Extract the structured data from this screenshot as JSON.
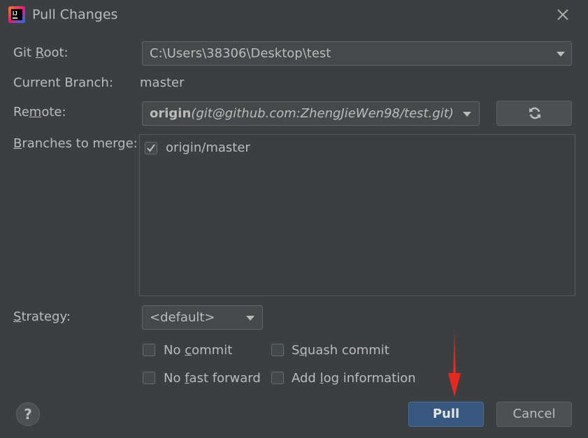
{
  "window": {
    "title": "Pull Changes"
  },
  "form": {
    "git_root_label_pre": "Git ",
    "git_root_label_mn": "R",
    "git_root_label_post": "oot:",
    "git_root_value": "C:\\Users\\38306\\Desktop\\test",
    "current_branch_label": "Current Branch:",
    "current_branch_value": "master",
    "remote_label_pre": "Re",
    "remote_label_mn": "m",
    "remote_label_post": "ote:",
    "remote_name": "origin",
    "remote_url": "(git@github.com:ZhengJieWen98/test.git)",
    "branches_label_mn": "B",
    "branches_label_post": "ranches to merge:",
    "branches": [
      {
        "name": "origin/master",
        "checked": true
      }
    ],
    "strategy_label_mn": "S",
    "strategy_label_post": "trategy:",
    "strategy_value": "<default>"
  },
  "options": {
    "no_commit": {
      "pre": "No ",
      "mn": "c",
      "post": "ommit",
      "checked": false
    },
    "squash_commit": {
      "pre": "S",
      "mn": "q",
      "post": "uash commit",
      "checked": false
    },
    "no_fast_forward": {
      "pre": "No ",
      "mn": "f",
      "post": "ast forward",
      "checked": false
    },
    "add_log": {
      "pre": "Add ",
      "mn": "l",
      "post": "og information",
      "checked": false
    }
  },
  "buttons": {
    "pull": "Pull",
    "cancel": "Cancel",
    "help": "?"
  },
  "colors": {
    "background": "#3c3f41",
    "primary_button": "#365880",
    "annotation_arrow": "#e8271f"
  }
}
